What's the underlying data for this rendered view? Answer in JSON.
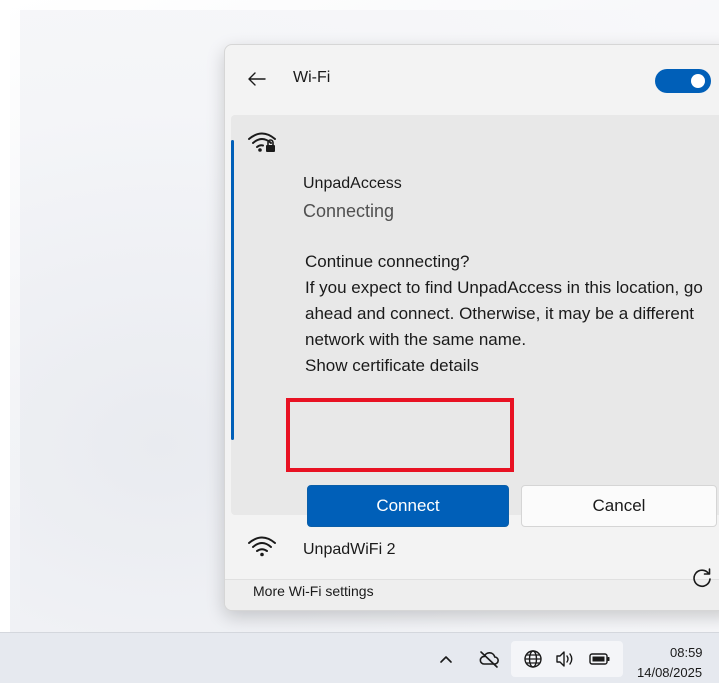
{
  "wifi_panel": {
    "title": "Wi-Fi",
    "toggle_on": true,
    "accent_color": "#005fb8"
  },
  "networks": [
    {
      "name": "UnpadAccess",
      "status": "Connecting",
      "secured": true,
      "prompt": {
        "heading": "Continue connecting?",
        "body": "If you expect to find UnpadAccess in this location, go ahead and connect. Otherwise, it may be a different network with the same name.",
        "link": "Show certificate details",
        "connect_label": "Connect",
        "cancel_label": "Cancel"
      }
    },
    {
      "name": "UnpadWiFi 2",
      "secured": false
    }
  ],
  "footer": {
    "more_settings_label": "More Wi-Fi settings",
    "refresh_icon": "refresh-icon"
  },
  "highlight_color": "#e81123",
  "taskbar": {
    "time": "08:59",
    "date": "14/08/2025",
    "icons": [
      "chevron-up-icon",
      "cloud-off-icon",
      "globe-network-icon",
      "speaker-icon",
      "battery-icon"
    ]
  }
}
